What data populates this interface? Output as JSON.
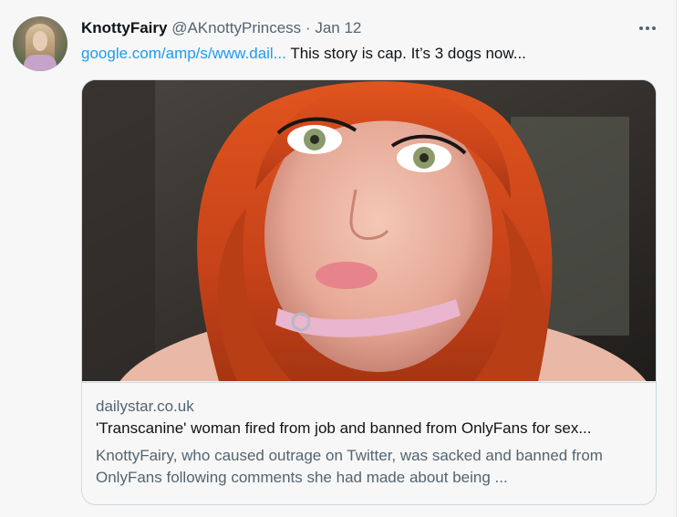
{
  "tweet": {
    "display_name": "KnottyFairy",
    "handle": "@AKnottyPrincess",
    "separator": "·",
    "date": "Jan 12",
    "link_text": "google.com/amp/s/www.dail...",
    "text": "This story is cap. It’s 3 dogs now..."
  },
  "card": {
    "domain": "dailystar.co.uk",
    "title": "'Transcanine' woman fired from job and banned from OnlyFans for sex...",
    "description": "KnottyFairy, who caused outrage on Twitter, was sacked and banned from OnlyFans following comments she had made about being ..."
  },
  "icons": {
    "more": "more-options-icon"
  },
  "colors": {
    "link": "#1d9bf0",
    "secondary_text": "#536471",
    "primary_text": "#0f1419",
    "border": "#cfd9de",
    "background": "#f7f7f7"
  }
}
